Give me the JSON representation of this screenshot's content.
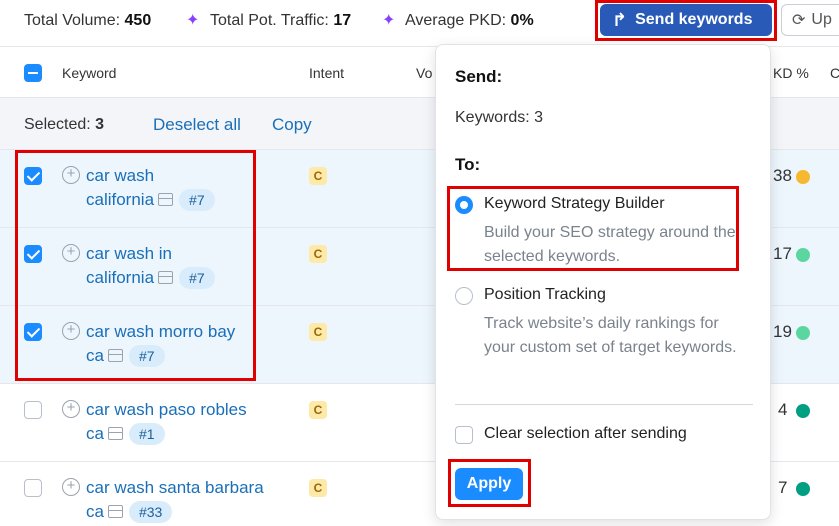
{
  "stats": [
    {
      "label": "Total Volume:",
      "value": "450"
    },
    {
      "label": "Total Pot. Traffic:",
      "value": "17"
    },
    {
      "label": "Average PKD:",
      "value": "0%"
    }
  ],
  "toolbar": {
    "send_label": "Send keywords",
    "update_label": "Up"
  },
  "columns": {
    "keyword": "Keyword",
    "intent": "Intent",
    "volume": "Vo",
    "kd": "KD %",
    "extra": "C"
  },
  "selection": {
    "label": "Selected:",
    "count": "3",
    "deselect": "Deselect all",
    "copy": "Copy"
  },
  "rows": [
    {
      "line1": "car wash",
      "line2": "california",
      "position": "#7",
      "intent": "C",
      "kd": "38",
      "kd_color": "#f5b82e",
      "checked": true
    },
    {
      "line1": "car wash in",
      "line2": "california",
      "position": "#7",
      "intent": "C",
      "kd": "17",
      "kd_color": "#5cd6a0",
      "checked": true
    },
    {
      "line1": "car wash morro bay",
      "line2": "ca",
      "position": "#7",
      "intent": "C",
      "kd": "19",
      "kd_color": "#5cd6a0",
      "checked": true
    },
    {
      "line1": "car wash paso robles",
      "line2": "ca",
      "position": "#1",
      "intent": "C",
      "kd": "4",
      "kd_color": "#009f81",
      "checked": false
    },
    {
      "line1": "car wash santa barbara",
      "line2": "ca",
      "position": "#33",
      "intent": "C",
      "kd": "7",
      "kd_color": "#009f81",
      "checked": false
    }
  ],
  "popup": {
    "send_heading": "Send:",
    "keywords_count": "Keywords: 3",
    "to_heading": "To:",
    "options": [
      {
        "label": "Keyword Strategy Builder",
        "description": "Build your SEO strategy around the selected keywords.",
        "selected": true
      },
      {
        "label": "Position Tracking",
        "description": "Track website’s daily rankings for your custom set of target keywords.",
        "selected": false
      }
    ],
    "clear_label": "Clear selection after sending",
    "apply_label": "Apply"
  },
  "colors": {
    "accent": "#1a8cff",
    "send_button": "#2a5ab8",
    "highlight_box": "#e00000",
    "link": "#1a6fb8"
  }
}
